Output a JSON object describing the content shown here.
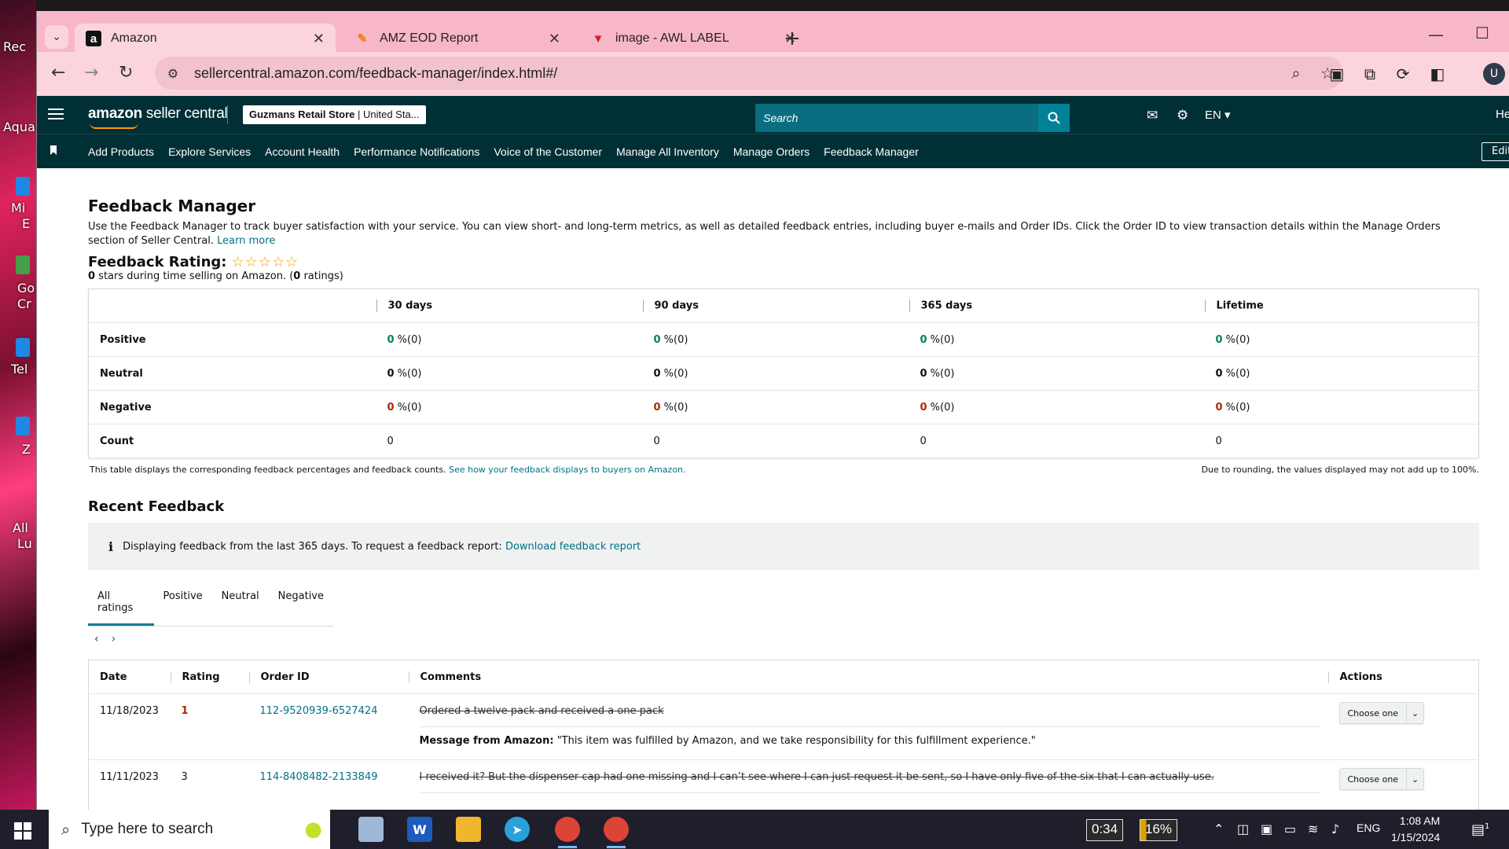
{
  "browser": {
    "tabs": [
      {
        "favicon": "a",
        "title": "Amazon",
        "active": true
      },
      {
        "favicon": "pen",
        "title": "AMZ EOD Report",
        "active": false
      },
      {
        "favicon": "v",
        "title": "image - AWL LABEL",
        "active": false
      }
    ],
    "url": "sellercentral.amazon.com/feedback-manager/index.html#/"
  },
  "header": {
    "logo_bold": "amazon",
    "logo_rest": " seller central",
    "store_name": "Guzmans Retail Store",
    "store_region": "United Sta...",
    "search_placeholder": "Search",
    "language": "EN",
    "help": "He"
  },
  "nav": {
    "links": [
      "Add Products",
      "Explore Services",
      "Account Health",
      "Performance Notifications",
      "Voice of the Customer",
      "Manage All Inventory",
      "Manage Orders",
      "Feedback Manager"
    ],
    "edit_label": "Edit"
  },
  "page": {
    "title": "Feedback Manager",
    "description": "Use the Feedback Manager to track buyer satisfaction with your service. You can view short- and long-term metrics, as well as detailed feedback entries, including buyer e-mails and Order IDs. Click the Order ID to view transaction details within the Manage Orders section of Seller Central.",
    "learn_more": "Learn more",
    "rating_label": "Feedback Rating:",
    "stars": "☆☆☆☆☆",
    "stars_value": "0",
    "stars_text_a": " stars during time selling on Amazon. (",
    "ratings_count": "0",
    "stars_text_b": " ratings)"
  },
  "metrics": {
    "columns": [
      "30 days",
      "90 days",
      "365 days",
      "Lifetime"
    ],
    "rows": [
      {
        "label": "Positive",
        "kind": "pos",
        "values": [
          "0",
          "0",
          "0",
          "0"
        ],
        "suffix": " %(0)"
      },
      {
        "label": "Neutral",
        "kind": "neu",
        "values": [
          "0",
          "0",
          "0",
          "0"
        ],
        "suffix": " %(0)"
      },
      {
        "label": "Negative",
        "kind": "neg",
        "values": [
          "0",
          "0",
          "0",
          "0"
        ],
        "suffix": " %(0)"
      },
      {
        "label": "Count",
        "kind": "count",
        "values": [
          "0",
          "0",
          "0",
          "0"
        ],
        "suffix": ""
      }
    ],
    "note_left": "This table displays the corresponding feedback percentages and feedback counts.",
    "note_link": "See how your feedback displays to buyers on Amazon.",
    "note_right": "Due to rounding, the values displayed may not add up to 100%."
  },
  "recent": {
    "title": "Recent Feedback",
    "info_text": "Displaying feedback from the last 365 days. To request a feedback report:",
    "info_link": "Download feedback report",
    "filter_tabs": [
      "All ratings",
      "Positive",
      "Neutral",
      "Negative"
    ],
    "columns": [
      "Date",
      "Rating",
      "Order ID",
      "Comments",
      "Actions"
    ],
    "rows": [
      {
        "date": "11/18/2023",
        "rating": "1",
        "order_id": "112-9520939-6527424",
        "comment": "Ordered a twelve pack and received a one pack",
        "message_label": "Message from Amazon:",
        "message": " \"This item was fulfilled by Amazon, and we take responsibility for this fulfillment experience.\"",
        "action": "Choose one"
      },
      {
        "date": "11/11/2023",
        "rating": "3",
        "order_id": "114-8408482-2133849",
        "comment": "I received it? But the dispenser cap had one missing and I can’t see where I can just request it be sent, so I have only five of the six that I can actually use.",
        "action": "Choose one"
      }
    ]
  },
  "desktop": {
    "labels": [
      "Rec",
      "Aqua",
      "Mi",
      "E",
      "Go",
      "Cr",
      "Tel",
      "Z",
      "All",
      "Lu"
    ]
  },
  "taskbar": {
    "search_placeholder": "Type here to search",
    "timer": "0:34",
    "battery": "16%",
    "language": "ENG",
    "time": "1:08 AM",
    "date": "1/15/2024",
    "notif_count": "1"
  },
  "colors": {
    "tab_strip": "#f8b7c8",
    "sc_header": "#002f36",
    "link": "#007185",
    "positive": "#067d62",
    "negative": "#b12704"
  }
}
